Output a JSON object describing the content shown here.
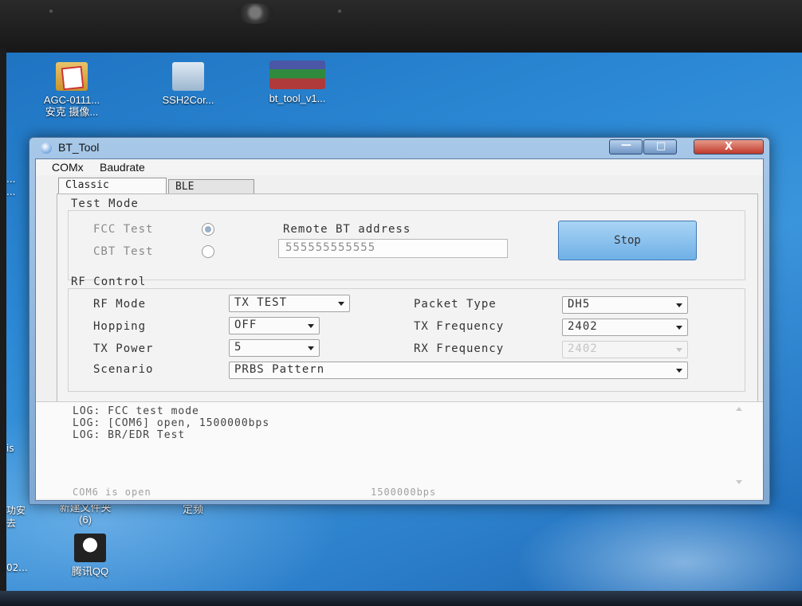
{
  "desktop": {
    "icons": [
      {
        "label": "AGC-0111...",
        "sublabel": "安克 摄像..."
      },
      {
        "label": "SSH2Cor...",
        "sublabel": ""
      },
      {
        "label": "bt_tool_v1...",
        "sublabel": ""
      },
      {
        "label": "新建文件夹",
        "sublabel": "(6)"
      },
      {
        "label": "定频",
        "sublabel": ""
      },
      {
        "label": "腾讯QQ",
        "sublabel": ""
      }
    ],
    "edge_texts": [
      "...",
      "...",
      "is",
      "功安",
      "去",
      "02..."
    ]
  },
  "window": {
    "title": "BT_Tool",
    "caption": {
      "min": "—",
      "max": "□",
      "close": "X"
    },
    "menu": [
      "COMx",
      "Baudrate"
    ],
    "tabs": [
      "Classic",
      "BLE"
    ],
    "test_mode": {
      "heading": "Test Mode",
      "fcc_label": "FCC Test",
      "cbt_label": "CBT Test",
      "selected": "FCC Test",
      "remote_label": "Remote BT address",
      "remote_value": "555555555555",
      "stop_label": "Stop"
    },
    "rf_control": {
      "heading": "RF Control",
      "rf_mode_label": "RF Mode",
      "rf_mode_value": "TX TEST",
      "hopping_label": "Hopping",
      "hopping_value": "OFF",
      "tx_power_label": "TX Power",
      "tx_power_value": "5",
      "scenario_label": "Scenario",
      "scenario_value": "PRBS Pattern",
      "packet_type_label": "Packet Type",
      "packet_type_value": "DH5",
      "tx_freq_label": "TX Frequency",
      "tx_freq_value": "2402",
      "rx_freq_label": "RX Frequency",
      "rx_freq_value": "2402"
    },
    "log": [
      "LOG: FCC test mode",
      "LOG: [COM6] open, 1500000bps",
      "LOG: BR/EDR Test"
    ],
    "status": {
      "port": "COM6 is open",
      "baud": "1500000bps"
    }
  }
}
